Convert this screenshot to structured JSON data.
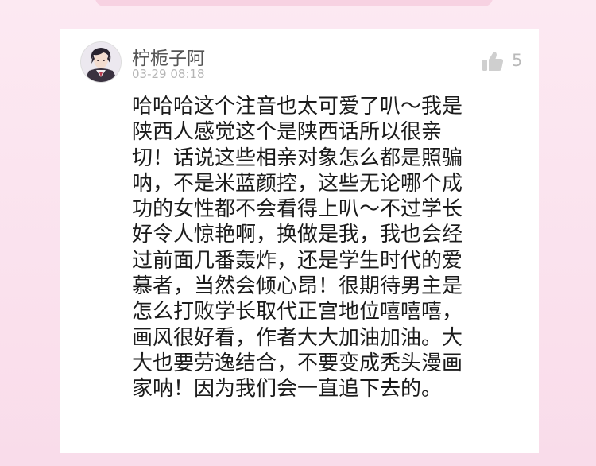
{
  "comment": {
    "username": "柠栀子阿",
    "timestamp": "03-29 08:18",
    "likes": "5",
    "text": "哈哈哈这个注音也太可爱了叭～我是\n陕西人感觉这个是陕西话所以很亲\n切！话说这些相亲对象怎么都是照骗\n呐，不是米蓝颜控，这些无论哪个成\n功的女性都不会看得上叭～不过学长\n好令人惊艳啊，换做是我，我也会经\n过前面几番轰炸，还是学生时代的爱\n慕者，当然会倾心昂！很期待男主是\n怎么打败学长取代正宫地位嘻嘻嘻，\n画风很好看，作者大大加油加油。大\n大也要劳逸结合，不要变成秃头漫画\n家呐！因为我们会一直追下去的。"
  },
  "icons": {
    "like": "thumbs-up-icon",
    "avatar": "user-avatar"
  },
  "colors": {
    "background": "#fbe3ee",
    "card": "#ffffff",
    "username": "#555555",
    "timestamp": "#b5b5b5",
    "like_icon": "#cfcfcf",
    "text": "#1b1b1b"
  }
}
